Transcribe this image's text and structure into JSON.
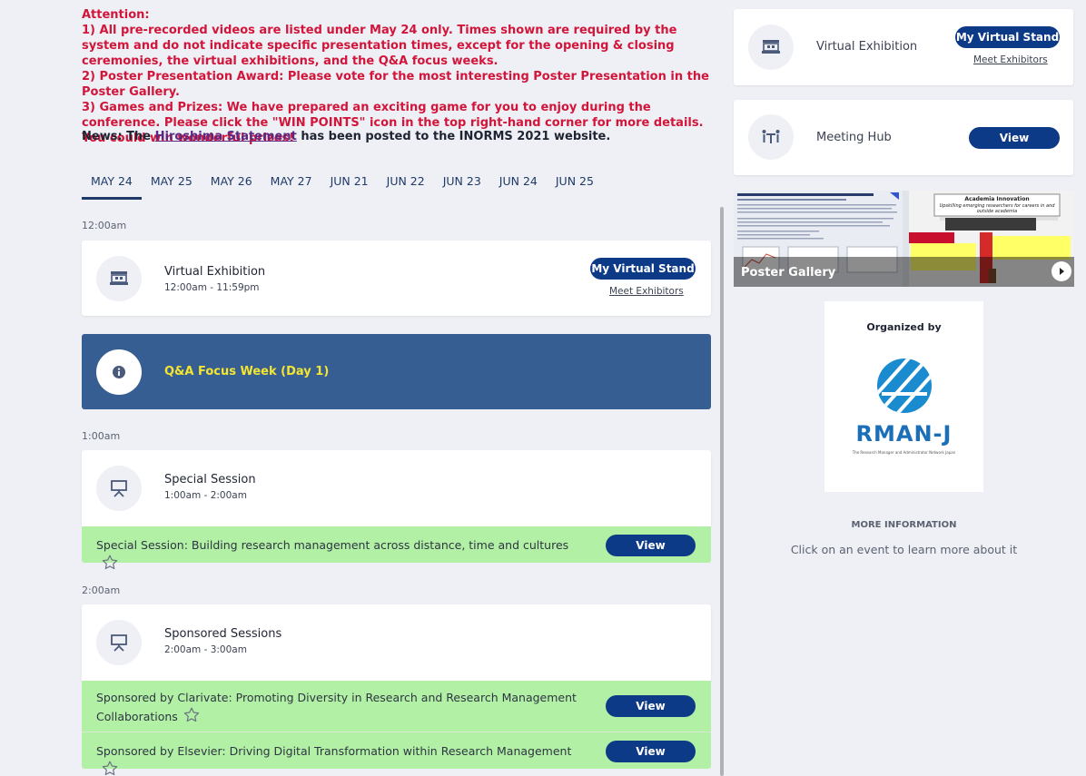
{
  "notice": {
    "line0": "Attention:",
    "line1": "1) All pre-recorded videos are listed under May 24 only. Times shown are required by the system and do not indicate specific presentation times, except for the opening & closing ceremonies, the virtual exhibitions, and the Q&A focus weeks.",
    "line2": "2) Poster Presentation Award: Please vote for the most interesting Poster Presentation in the Poster Gallery.",
    "line3": "3) Games and Prizes: We have prepared an exciting game for you to enjoy during the conference. Please click the \"WIN POINTS\" icon in the top right-hand corner for more details. You could win wonderful prizes!"
  },
  "news": {
    "prefix": "News: The ",
    "link": "Hiroshima Statement",
    "suffix": " has been posted to the INORMS 2021 website."
  },
  "tabs": [
    {
      "label": "MAY 24",
      "active": true
    },
    {
      "label": "MAY 25"
    },
    {
      "label": "MAY 26"
    },
    {
      "label": "MAY 27"
    },
    {
      "label": "JUN 21"
    },
    {
      "label": "JUN 22"
    },
    {
      "label": "JUN 23"
    },
    {
      "label": "JUN 24"
    },
    {
      "label": "JUN 25"
    }
  ],
  "schedule": {
    "t1": "12:00am",
    "t2": "1:00am",
    "t3": "2:00am",
    "virtual_exhibition": {
      "title": "Virtual Exhibition",
      "time": "12:00am - 11:59pm",
      "button": "My Virtual Stand",
      "link": "Meet Exhibitors"
    },
    "qa_banner": "Q&A Focus Week (Day 1)",
    "special": {
      "title": "Special Session",
      "time": "1:00am - 2:00am",
      "item": "Special Session: Building research management across distance, time and cultures",
      "button": "View"
    },
    "sponsored": {
      "title": "Sponsored Sessions",
      "time": "2:00am - 3:00am",
      "item1": "Sponsored by Clarivate: Promoting Diversity in Research and Research Management Collaborations",
      "item2": "Sponsored by Elsevier: Driving Digital Transformation within Research Management",
      "button": "View"
    }
  },
  "sidebar": {
    "virtual_exhibition": {
      "label": "Virtual Exhibition",
      "button": "My Virtual Stand",
      "link": "Meet Exhibitors"
    },
    "meeting_hub": {
      "label": "Meeting Hub",
      "button": "View"
    },
    "poster_gallery": {
      "label": "Poster Gallery",
      "slide_title": "Academia Innovation",
      "slide_subtitle": "Upskilling emerging researchers for careers in and outside academia"
    },
    "organized_by": {
      "label": "Organized by",
      "org_name": "RMAN-J",
      "org_tagline": "The Research Manager and Administrator Network Japan"
    },
    "more_info": {
      "title": "MORE INFORMATION",
      "text": "Click on an event to learn more about it"
    }
  },
  "colors": {
    "accent": "#0d3a86",
    "notice_red": "#d2153a",
    "banner_blue": "#365e92",
    "banner_text": "#f4e532",
    "green_row": "#b1f0a5",
    "rmanj_blue": "#1b8bd0"
  },
  "icons": {
    "exhibition": "booth-icon",
    "qa": "info-icon",
    "session": "presentation-board-icon",
    "meeting": "meeting-icon",
    "star": "star-outline-icon",
    "play": "play-icon"
  }
}
